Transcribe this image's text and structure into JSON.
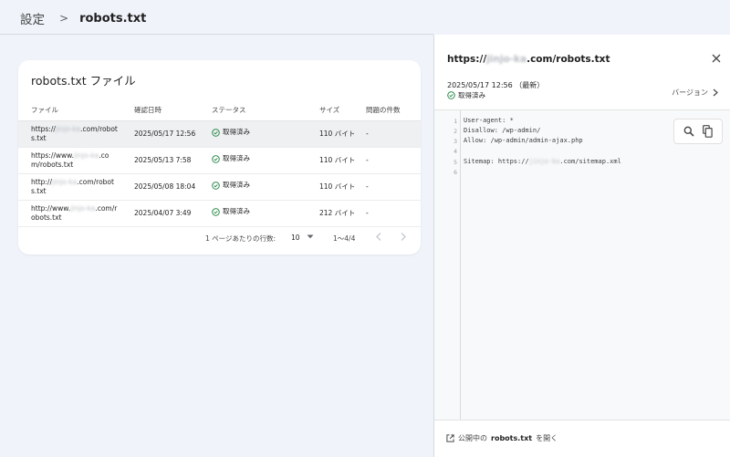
{
  "breadcrumb": {
    "parent": "設定",
    "separator": ">",
    "current": "robots.txt"
  },
  "card": {
    "title": "robots.txt ファイル",
    "columns": [
      "ファイル",
      "確認日時",
      "ステータス",
      "サイズ",
      "問題の件数"
    ],
    "rows": [
      {
        "url_prefix": "https://",
        "url_masked": "jinjo-ka",
        "url_suffix": ".com/robots.txt",
        "checked": "2025/05/17 12:56",
        "status": "取得済み",
        "size": "110 バイト",
        "issues": "-"
      },
      {
        "url_prefix": "https://www.",
        "url_masked": "jinjo-ka",
        "url_suffix": ".com/robots.txt",
        "checked": "2025/05/13 7:58",
        "status": "取得済み",
        "size": "110 バイト",
        "issues": "-"
      },
      {
        "url_prefix": "http://",
        "url_masked": "jinjo-ka",
        "url_suffix": ".com/robots.txt",
        "checked": "2025/05/08 18:04",
        "status": "取得済み",
        "size": "110 バイト",
        "issues": "-"
      },
      {
        "url_prefix": "http://www.",
        "url_masked": "jinjo-ka",
        "url_suffix": ".com/robots.txt",
        "checked": "2025/04/07 3:49",
        "status": "取得済み",
        "size": "212 バイト",
        "issues": "-"
      }
    ],
    "pagination": {
      "rows_per_page_label": "1 ページあたりの行数:",
      "rows_per_page": "10",
      "range": "1～4/4"
    }
  },
  "panel": {
    "url_prefix": "https://",
    "url_masked": "jinjo-ka",
    "url_suffix": ".com/robots.txt",
    "date": "2025/05/17 12:56 （最新）",
    "status": "取得済み",
    "version_label": "バージョン",
    "code": {
      "line_numbers": [
        "1",
        "2",
        "3",
        "4",
        "5",
        "6"
      ],
      "line1": "User-agent: *",
      "line2": "Disallow: /wp-admin/",
      "line3": "Allow: /wp-admin/admin-ajax.php",
      "line4": "",
      "line5_prefix": "Sitemap: https://",
      "line5_masked": "jinjo-ka",
      "line5_suffix": ".com/sitemap.xml",
      "line6": ""
    },
    "footer": {
      "pre": "公開中の",
      "bold": "robots.txt",
      "post": "を開く"
    }
  },
  "colors": {
    "accent_green": "#188038",
    "background": "#f0f3fa",
    "selected_row": "#eef0f2"
  },
  "icons": [
    "chevron-right-icon",
    "check-circle-icon",
    "close-icon",
    "search-icon",
    "copy-icon",
    "open-in-new-icon",
    "dropdown-arrow-icon",
    "chevron-left-icon"
  ]
}
